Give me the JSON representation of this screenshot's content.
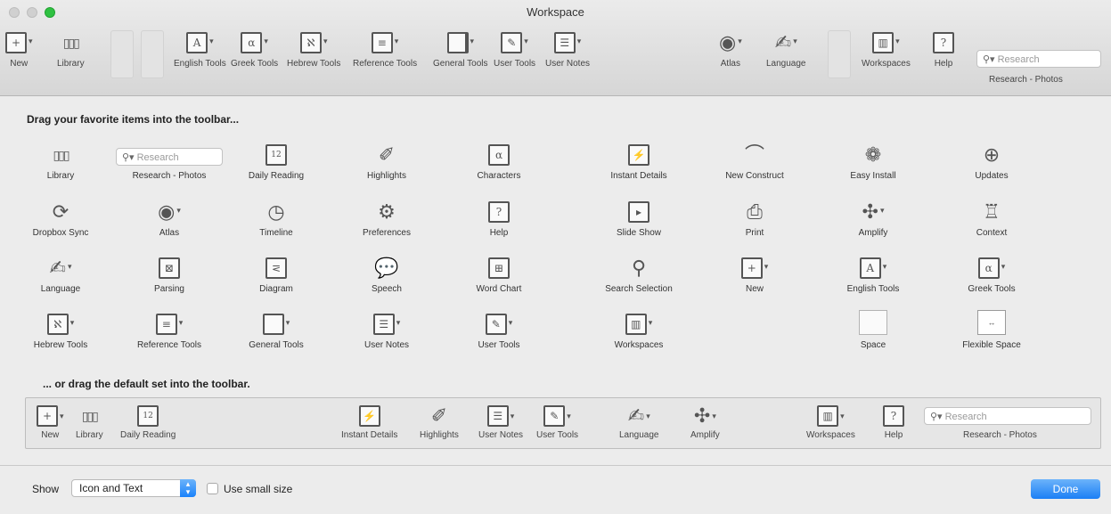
{
  "window": {
    "title": "Workspace"
  },
  "toolbar": {
    "items": [
      {
        "label": "New",
        "icon": "new-document-icon",
        "glyph": "+"
      },
      {
        "label": "Library",
        "icon": "library-icon",
        "glyph": "▯▯▯"
      },
      {
        "label": "English Tools",
        "icon": "english-tools-icon",
        "glyph": "A"
      },
      {
        "label": "Greek Tools",
        "icon": "greek-tools-icon",
        "glyph": "α"
      },
      {
        "label": "Hebrew Tools",
        "icon": "hebrew-tools-icon",
        "glyph": "ℵ"
      },
      {
        "label": "Reference Tools",
        "icon": "reference-tools-icon",
        "glyph": "≡"
      },
      {
        "label": "General Tools",
        "icon": "general-tools-icon",
        "glyph": ""
      },
      {
        "label": "User Tools",
        "icon": "user-tools-icon",
        "glyph": "✎"
      },
      {
        "label": "User Notes",
        "icon": "user-notes-icon",
        "glyph": "☰"
      },
      {
        "label": "Atlas",
        "icon": "atlas-icon",
        "glyph": "◉"
      },
      {
        "label": "Language",
        "icon": "language-icon",
        "glyph": "✍"
      },
      {
        "label": "Workspaces",
        "icon": "workspaces-icon",
        "glyph": "▥"
      },
      {
        "label": "Help",
        "icon": "help-icon",
        "glyph": "?"
      }
    ],
    "search_placeholder": "Research",
    "search_label": "Research - Photos"
  },
  "panel": {
    "heading": "Drag your favorite items into the toolbar...",
    "items": [
      {
        "label": "Library",
        "icon": "library-icon",
        "glyph": "▯▯▯"
      },
      {
        "label": "Research - Photos",
        "icon": "search-field-icon",
        "glyph": ""
      },
      {
        "label": "Daily Reading",
        "icon": "calendar-icon",
        "glyph": "12"
      },
      {
        "label": "Highlights",
        "icon": "highlighter-icon",
        "glyph": "✐"
      },
      {
        "label": "Characters",
        "icon": "characters-icon",
        "glyph": "α"
      },
      {
        "label": "Instant Details",
        "icon": "instant-details-icon",
        "glyph": "⚡"
      },
      {
        "label": "New Construct",
        "icon": "new-construct-icon",
        "glyph": "⌒"
      },
      {
        "label": "Easy Install",
        "icon": "easy-install-icon",
        "glyph": "❁"
      },
      {
        "label": "Updates",
        "icon": "updates-icon",
        "glyph": "⊕"
      },
      {
        "label": "Dropbox Sync",
        "icon": "sync-icon",
        "glyph": "⟳"
      },
      {
        "label": "Atlas",
        "icon": "atlas-icon",
        "glyph": "◉"
      },
      {
        "label": "Timeline",
        "icon": "timeline-icon",
        "glyph": "◷"
      },
      {
        "label": "Preferences",
        "icon": "gears-icon",
        "glyph": "⚙"
      },
      {
        "label": "Help",
        "icon": "help-icon",
        "glyph": "?"
      },
      {
        "label": "Slide Show",
        "icon": "slideshow-icon",
        "glyph": "▸"
      },
      {
        "label": "Print",
        "icon": "printer-icon",
        "glyph": "⎙"
      },
      {
        "label": "Amplify",
        "icon": "amplify-icon",
        "glyph": "✣"
      },
      {
        "label": "Context",
        "icon": "context-icon",
        "glyph": "♖"
      },
      {
        "label": "Language",
        "icon": "language-icon",
        "glyph": "✍"
      },
      {
        "label": "Parsing",
        "icon": "parsing-icon",
        "glyph": "⊠"
      },
      {
        "label": "Diagram",
        "icon": "diagram-icon",
        "glyph": "⋜"
      },
      {
        "label": "Speech",
        "icon": "speech-bubble-icon",
        "glyph": "💬"
      },
      {
        "label": "Word Chart",
        "icon": "word-chart-icon",
        "glyph": "⊞"
      },
      {
        "label": "Search Selection",
        "icon": "search-selection-icon",
        "glyph": "⚲"
      },
      {
        "label": "New",
        "icon": "new-document-icon",
        "glyph": "+"
      },
      {
        "label": "English Tools",
        "icon": "english-tools-icon",
        "glyph": "A"
      },
      {
        "label": "Greek Tools",
        "icon": "greek-tools-icon",
        "glyph": "α"
      },
      {
        "label": "Hebrew Tools",
        "icon": "hebrew-tools-icon",
        "glyph": "ℵ"
      },
      {
        "label": "Reference Tools",
        "icon": "reference-tools-icon",
        "glyph": "≡"
      },
      {
        "label": "General Tools",
        "icon": "general-tools-icon",
        "glyph": ""
      },
      {
        "label": "User Notes",
        "icon": "user-notes-icon",
        "glyph": "☰"
      },
      {
        "label": "User Tools",
        "icon": "user-tools-icon",
        "glyph": "✎"
      },
      {
        "label": "Workspaces",
        "icon": "workspaces-icon",
        "glyph": "▥"
      },
      {
        "label": "Space",
        "icon": "space-icon",
        "glyph": ""
      },
      {
        "label": "Flexible Space",
        "icon": "flexible-space-icon",
        "glyph": "↔"
      }
    ]
  },
  "defaults": {
    "heading": "... or drag the default set into the toolbar.",
    "items": [
      {
        "label": "New",
        "icon": "new-document-icon",
        "glyph": "+"
      },
      {
        "label": "Library",
        "icon": "library-icon",
        "glyph": "▯▯▯"
      },
      {
        "label": "Daily Reading",
        "icon": "calendar-icon",
        "glyph": "12"
      },
      {
        "label": "Instant Details",
        "icon": "instant-details-icon",
        "glyph": "⚡"
      },
      {
        "label": "Highlights",
        "icon": "highlighter-icon",
        "glyph": "✐"
      },
      {
        "label": "User Notes",
        "icon": "user-notes-icon",
        "glyph": "☰"
      },
      {
        "label": "User Tools",
        "icon": "user-tools-icon",
        "glyph": "✎"
      },
      {
        "label": "Language",
        "icon": "language-icon",
        "glyph": "✍"
      },
      {
        "label": "Amplify",
        "icon": "amplify-icon",
        "glyph": "✣"
      },
      {
        "label": "Workspaces",
        "icon": "workspaces-icon",
        "glyph": "▥"
      },
      {
        "label": "Help",
        "icon": "help-icon",
        "glyph": "?"
      }
    ],
    "search_placeholder": "Research",
    "search_label": "Research - Photos"
  },
  "footer": {
    "show_label": "Show",
    "show_value": "Icon and Text",
    "small_size_label": "Use small size",
    "small_size_checked": false,
    "done_label": "Done"
  },
  "colors": {
    "accent": "#1b7ff5",
    "close_green": "#2fc142"
  }
}
